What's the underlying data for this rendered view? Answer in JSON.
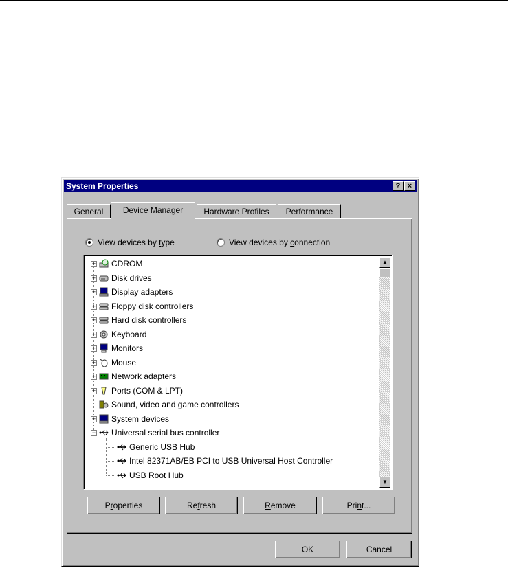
{
  "window": {
    "title": "System Properties",
    "help_glyph": "?",
    "close_glyph": "×"
  },
  "tabs": [
    {
      "label": "General"
    },
    {
      "label": "Device Manager",
      "active": true
    },
    {
      "label": "Hardware Profiles"
    },
    {
      "label": "Performance"
    }
  ],
  "view_options": {
    "by_type_prefix": "View devices by ",
    "by_type_accel": "t",
    "by_type_suffix": "ype",
    "by_type_selected": true,
    "by_connection_prefix": "View devices by ",
    "by_connection_accel": "c",
    "by_connection_suffix": "onnection",
    "by_connection_selected": false
  },
  "devices": [
    {
      "label": "CDROM",
      "icon": "cdrom-icon",
      "expander": "+"
    },
    {
      "label": "Disk drives",
      "icon": "disk-drive-icon",
      "expander": "+"
    },
    {
      "label": "Display adapters",
      "icon": "display-adapter-icon",
      "expander": "+"
    },
    {
      "label": "Floppy disk controllers",
      "icon": "floppy-controller-icon",
      "expander": "+"
    },
    {
      "label": "Hard disk controllers",
      "icon": "hard-disk-controller-icon",
      "expander": "+"
    },
    {
      "label": "Keyboard",
      "icon": "keyboard-icon",
      "expander": "+"
    },
    {
      "label": "Monitors",
      "icon": "monitor-icon",
      "expander": "+"
    },
    {
      "label": "Mouse",
      "icon": "mouse-icon",
      "expander": "+"
    },
    {
      "label": "Network adapters",
      "icon": "network-adapter-icon",
      "expander": "+"
    },
    {
      "label": "Ports (COM & LPT)",
      "icon": "port-icon",
      "expander": "+"
    },
    {
      "label": "Sound, video and game controllers",
      "icon": "sound-controller-icon",
      "expander": ""
    },
    {
      "label": "System devices",
      "icon": "system-device-icon",
      "expander": "+"
    },
    {
      "label": "Universal serial bus controller",
      "icon": "usb-icon",
      "expander": "−"
    }
  ],
  "usb_children": [
    {
      "label": "Generic USB Hub",
      "icon": "usb-icon"
    },
    {
      "label": "Intel 82371AB/EB PCI to USB Universal Host Controller",
      "icon": "usb-icon"
    },
    {
      "label": "USB Root Hub",
      "icon": "usb-icon"
    }
  ],
  "buttons": {
    "properties_pre": "P",
    "properties_accel": "r",
    "properties_post": "operties",
    "refresh_pre": "Re",
    "refresh_accel": "f",
    "refresh_post": "resh",
    "remove_pre": "",
    "remove_accel": "R",
    "remove_post": "emove",
    "print_pre": "Pri",
    "print_accel": "n",
    "print_post": "t...",
    "ok": "OK",
    "cancel": "Cancel"
  },
  "scrollbar": {
    "up_glyph": "▲",
    "down_glyph": "▼"
  }
}
